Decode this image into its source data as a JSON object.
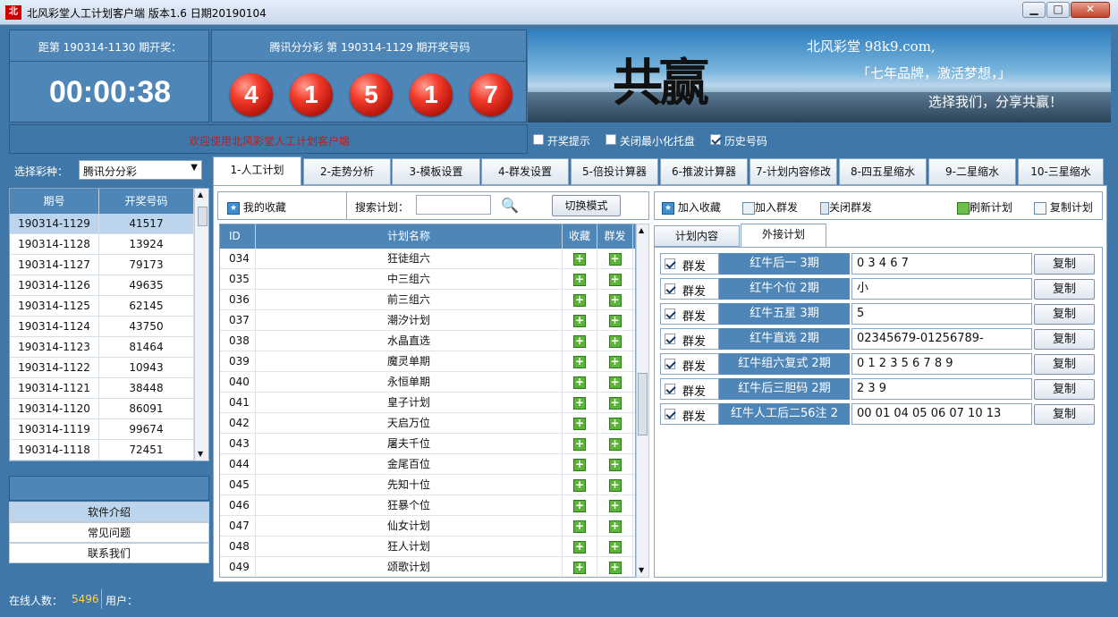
{
  "window": {
    "title": "北风彩堂人工计划客户端    版本1.6  日期20190104",
    "logo": "北"
  },
  "countdown": {
    "label": "距第 190314-1130 期开奖：",
    "time": "00:00:38"
  },
  "lottery": {
    "title": "腾讯分分彩 第 190314-1129 期开奖号码",
    "balls": [
      "4",
      "1",
      "5",
      "1",
      "7"
    ]
  },
  "banner": {
    "logo_text": "共赢",
    "site": "北风彩堂 98k9.com,",
    "slogan": "「七年品牌，激活梦想，」",
    "slogan2": "选择我们，分享共赢！"
  },
  "welcome": "欢迎使用北风彩堂人工计划客户端",
  "options": [
    {
      "label": "开奖提示",
      "checked": false
    },
    {
      "label": "关闭最小化托盘",
      "checked": false
    },
    {
      "label": "历史号码",
      "checked": true
    }
  ],
  "lottype": {
    "label": "选择彩种：",
    "value": "腾讯分分彩"
  },
  "history": {
    "headers": [
      "期号",
      "开奖号码"
    ],
    "rows": [
      [
        "190314-1129",
        "41517"
      ],
      [
        "190314-1128",
        "13924"
      ],
      [
        "190314-1127",
        "79173"
      ],
      [
        "190314-1126",
        "49635"
      ],
      [
        "190314-1125",
        "62145"
      ],
      [
        "190314-1124",
        "43750"
      ],
      [
        "190314-1123",
        "81464"
      ],
      [
        "190314-1122",
        "10943"
      ],
      [
        "190314-1121",
        "38448"
      ],
      [
        "190314-1120",
        "86091"
      ],
      [
        "190314-1119",
        "99674"
      ],
      [
        "190314-1118",
        "72451"
      ]
    ]
  },
  "left_menu": [
    "软件介绍",
    "常见问题",
    "联系我们"
  ],
  "tabs": [
    "1-人工计划",
    "2-走势分析",
    "3-模板设置",
    "4-群发设置",
    "5-倍投计算器",
    "6-推波计算器",
    "7-计划内容修改",
    "8-四五星缩水",
    "9-二星缩水",
    "10-三星缩水"
  ],
  "plan_toolbar": {
    "favorites": "我的收藏",
    "search_label": "搜索计划：",
    "search_value": "",
    "switch": "切换模式"
  },
  "plan_table": {
    "headers": [
      "ID",
      "计划名称",
      "收藏",
      "群发"
    ],
    "rows": [
      [
        "034",
        "狂徒组六"
      ],
      [
        "035",
        "中三组六"
      ],
      [
        "036",
        "前三组六"
      ],
      [
        "037",
        "潮汐计划"
      ],
      [
        "038",
        "水晶直选"
      ],
      [
        "039",
        "魔灵单期"
      ],
      [
        "040",
        "永恒单期"
      ],
      [
        "041",
        "皇子计划"
      ],
      [
        "042",
        "天启万位"
      ],
      [
        "043",
        "屠夫千位"
      ],
      [
        "044",
        "金尾百位"
      ],
      [
        "045",
        "先知十位"
      ],
      [
        "046",
        "狂暴个位"
      ],
      [
        "047",
        "仙女计划"
      ],
      [
        "048",
        "狂人计划"
      ],
      [
        "049",
        "颂歌计划"
      ]
    ]
  },
  "right_toolbar": {
    "add_fav": "加入收藏",
    "add_group": "加入群发",
    "close_group": "关闭群发",
    "refresh": "刷新计划",
    "copy": "复制计划"
  },
  "subtabs": [
    "计划内容",
    "外接计划"
  ],
  "ext_plans": [
    {
      "group": "群发",
      "name": "红牛后一 3期",
      "value": "0 3 4 6 7",
      "btn": "复制"
    },
    {
      "group": "群发",
      "name": "红牛个位 2期",
      "value": "小",
      "btn": "复制"
    },
    {
      "group": "群发",
      "name": "红牛五星 3期",
      "value": "5",
      "btn": "复制"
    },
    {
      "group": "群发",
      "name": "红牛直选 2期",
      "value": "02345679-01256789-",
      "btn": "复制"
    },
    {
      "group": "群发",
      "name": "红牛组六复式 2期",
      "value": "0 1 2 3 5 6 7 8 9",
      "btn": "复制"
    },
    {
      "group": "群发",
      "name": "红牛后三胆码 2期",
      "value": "2 3 9",
      "btn": "复制"
    },
    {
      "group": "群发",
      "name": "红牛人工后二56注 2",
      "value": "00 01 04 05 06 07 10 13",
      "btn": "复制"
    }
  ],
  "status": {
    "online_label": "在线人数：",
    "online_value": "5496",
    "user_label": "用户："
  }
}
